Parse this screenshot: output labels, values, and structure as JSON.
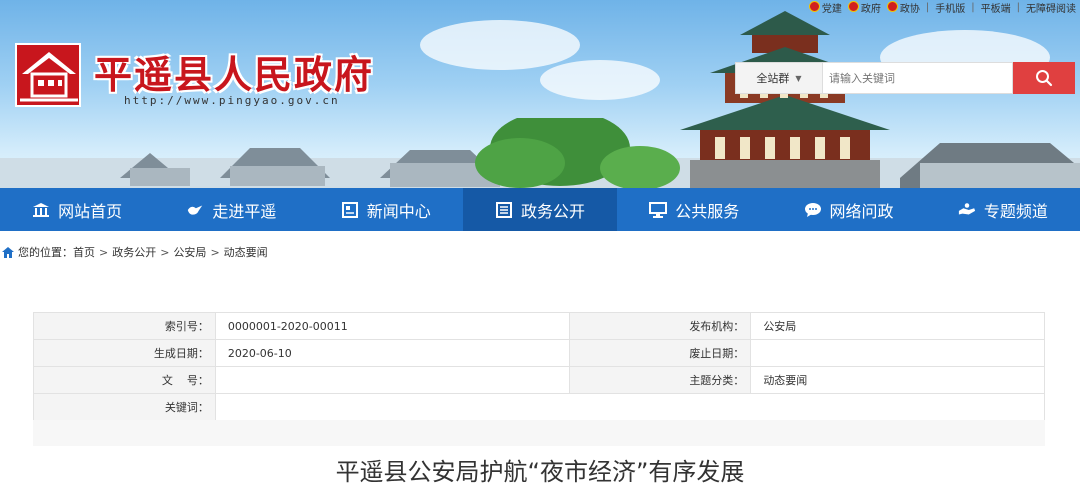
{
  "topbar": {
    "links": [
      "党建",
      "政府",
      "政协"
    ],
    "mobile": "手机版",
    "tablet": "平板端",
    "accessibility": "无障碍阅读"
  },
  "site": {
    "name": "平遥县人民政府",
    "url": "http://www.pingyao.gov.cn"
  },
  "search": {
    "scope": "全站群",
    "placeholder": "请输入关键词"
  },
  "nav": [
    {
      "label": "网站首页",
      "icon": "bank-icon"
    },
    {
      "label": "走进平遥",
      "icon": "bird-icon"
    },
    {
      "label": "新闻中心",
      "icon": "newspaper-icon"
    },
    {
      "label": "政务公开",
      "icon": "document-icon",
      "active": true
    },
    {
      "label": "公共服务",
      "icon": "monitor-icon"
    },
    {
      "label": "网络问政",
      "icon": "chat-icon"
    },
    {
      "label": "专题频道",
      "icon": "hand-icon"
    }
  ],
  "breadcrumb": {
    "prefix": "您的位置：",
    "items": [
      "首页",
      "政务公开",
      "公安局",
      "动态要闻"
    ]
  },
  "info": {
    "index_label": "索引号：",
    "index_value": "0000001-2020-00011",
    "publisher_label": "发布机构：",
    "publisher_value": "公安局",
    "created_label": "生成日期：",
    "created_value": "2020-06-10",
    "expire_label": "废止日期：",
    "expire_value": "",
    "docno_label": "文    号：",
    "docno_value": "",
    "category_label": "主题分类：",
    "category_value": "动态要闻",
    "keywords_label": "关键词：",
    "keywords_value": ""
  },
  "article": {
    "title": "平遥县公安局护航“夜市经济”有序发展"
  },
  "colors": {
    "nav_bg": "#1f6fc6",
    "nav_active": "#1559a6",
    "brand_red": "#c8161d",
    "search_btn": "#e04040"
  }
}
